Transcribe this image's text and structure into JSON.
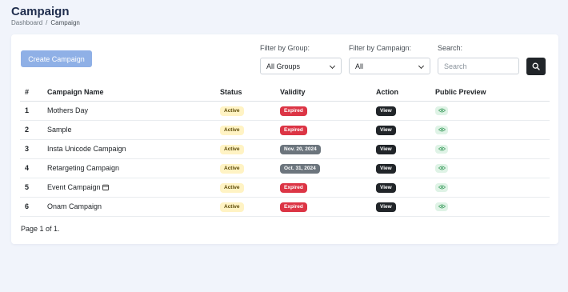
{
  "header": {
    "title": "Campaign",
    "breadcrumb": [
      "Dashboard",
      "Campaign"
    ]
  },
  "toolbar": {
    "create_label": "Create Campaign",
    "filter_group": {
      "label": "Filter by Group:",
      "value": "All Groups"
    },
    "filter_campaign": {
      "label": "Filter by Campaign:",
      "value": "All"
    },
    "search": {
      "label": "Search:",
      "placeholder": "Search"
    }
  },
  "table": {
    "columns": [
      "#",
      "Campaign Name",
      "Status",
      "Validity",
      "Action",
      "Public Preview"
    ],
    "rows": [
      {
        "num": "1",
        "name": "Mothers Day",
        "status": "Active",
        "validity": "Expired",
        "validity_type": "expired",
        "action": "View"
      },
      {
        "num": "2",
        "name": "Sample",
        "status": "Active",
        "validity": "Expired",
        "validity_type": "expired",
        "action": "View"
      },
      {
        "num": "3",
        "name": "Insta Unicode Campaign",
        "status": "Active",
        "validity": "Nov. 20, 2024",
        "validity_type": "date",
        "action": "View"
      },
      {
        "num": "4",
        "name": "Retargeting Campaign",
        "status": "Active",
        "validity": "Oct. 31, 2024",
        "validity_type": "date",
        "action": "View"
      },
      {
        "num": "5",
        "name": "Event Campaign",
        "status": "Active",
        "validity": "Expired",
        "validity_type": "expired",
        "action": "View",
        "icon": "calendar-icon"
      },
      {
        "num": "6",
        "name": "Onam Campaign",
        "status": "Active",
        "validity": "Expired",
        "validity_type": "expired",
        "action": "View"
      }
    ]
  },
  "pagination": {
    "text": "Page 1 of 1."
  },
  "colors": {
    "primary_button": "#8fb0e6",
    "expired": "#dc3545",
    "date": "#6c757d",
    "active_bg": "#fff3c4",
    "view": "#212529",
    "preview_bg": "#dff3e6"
  }
}
